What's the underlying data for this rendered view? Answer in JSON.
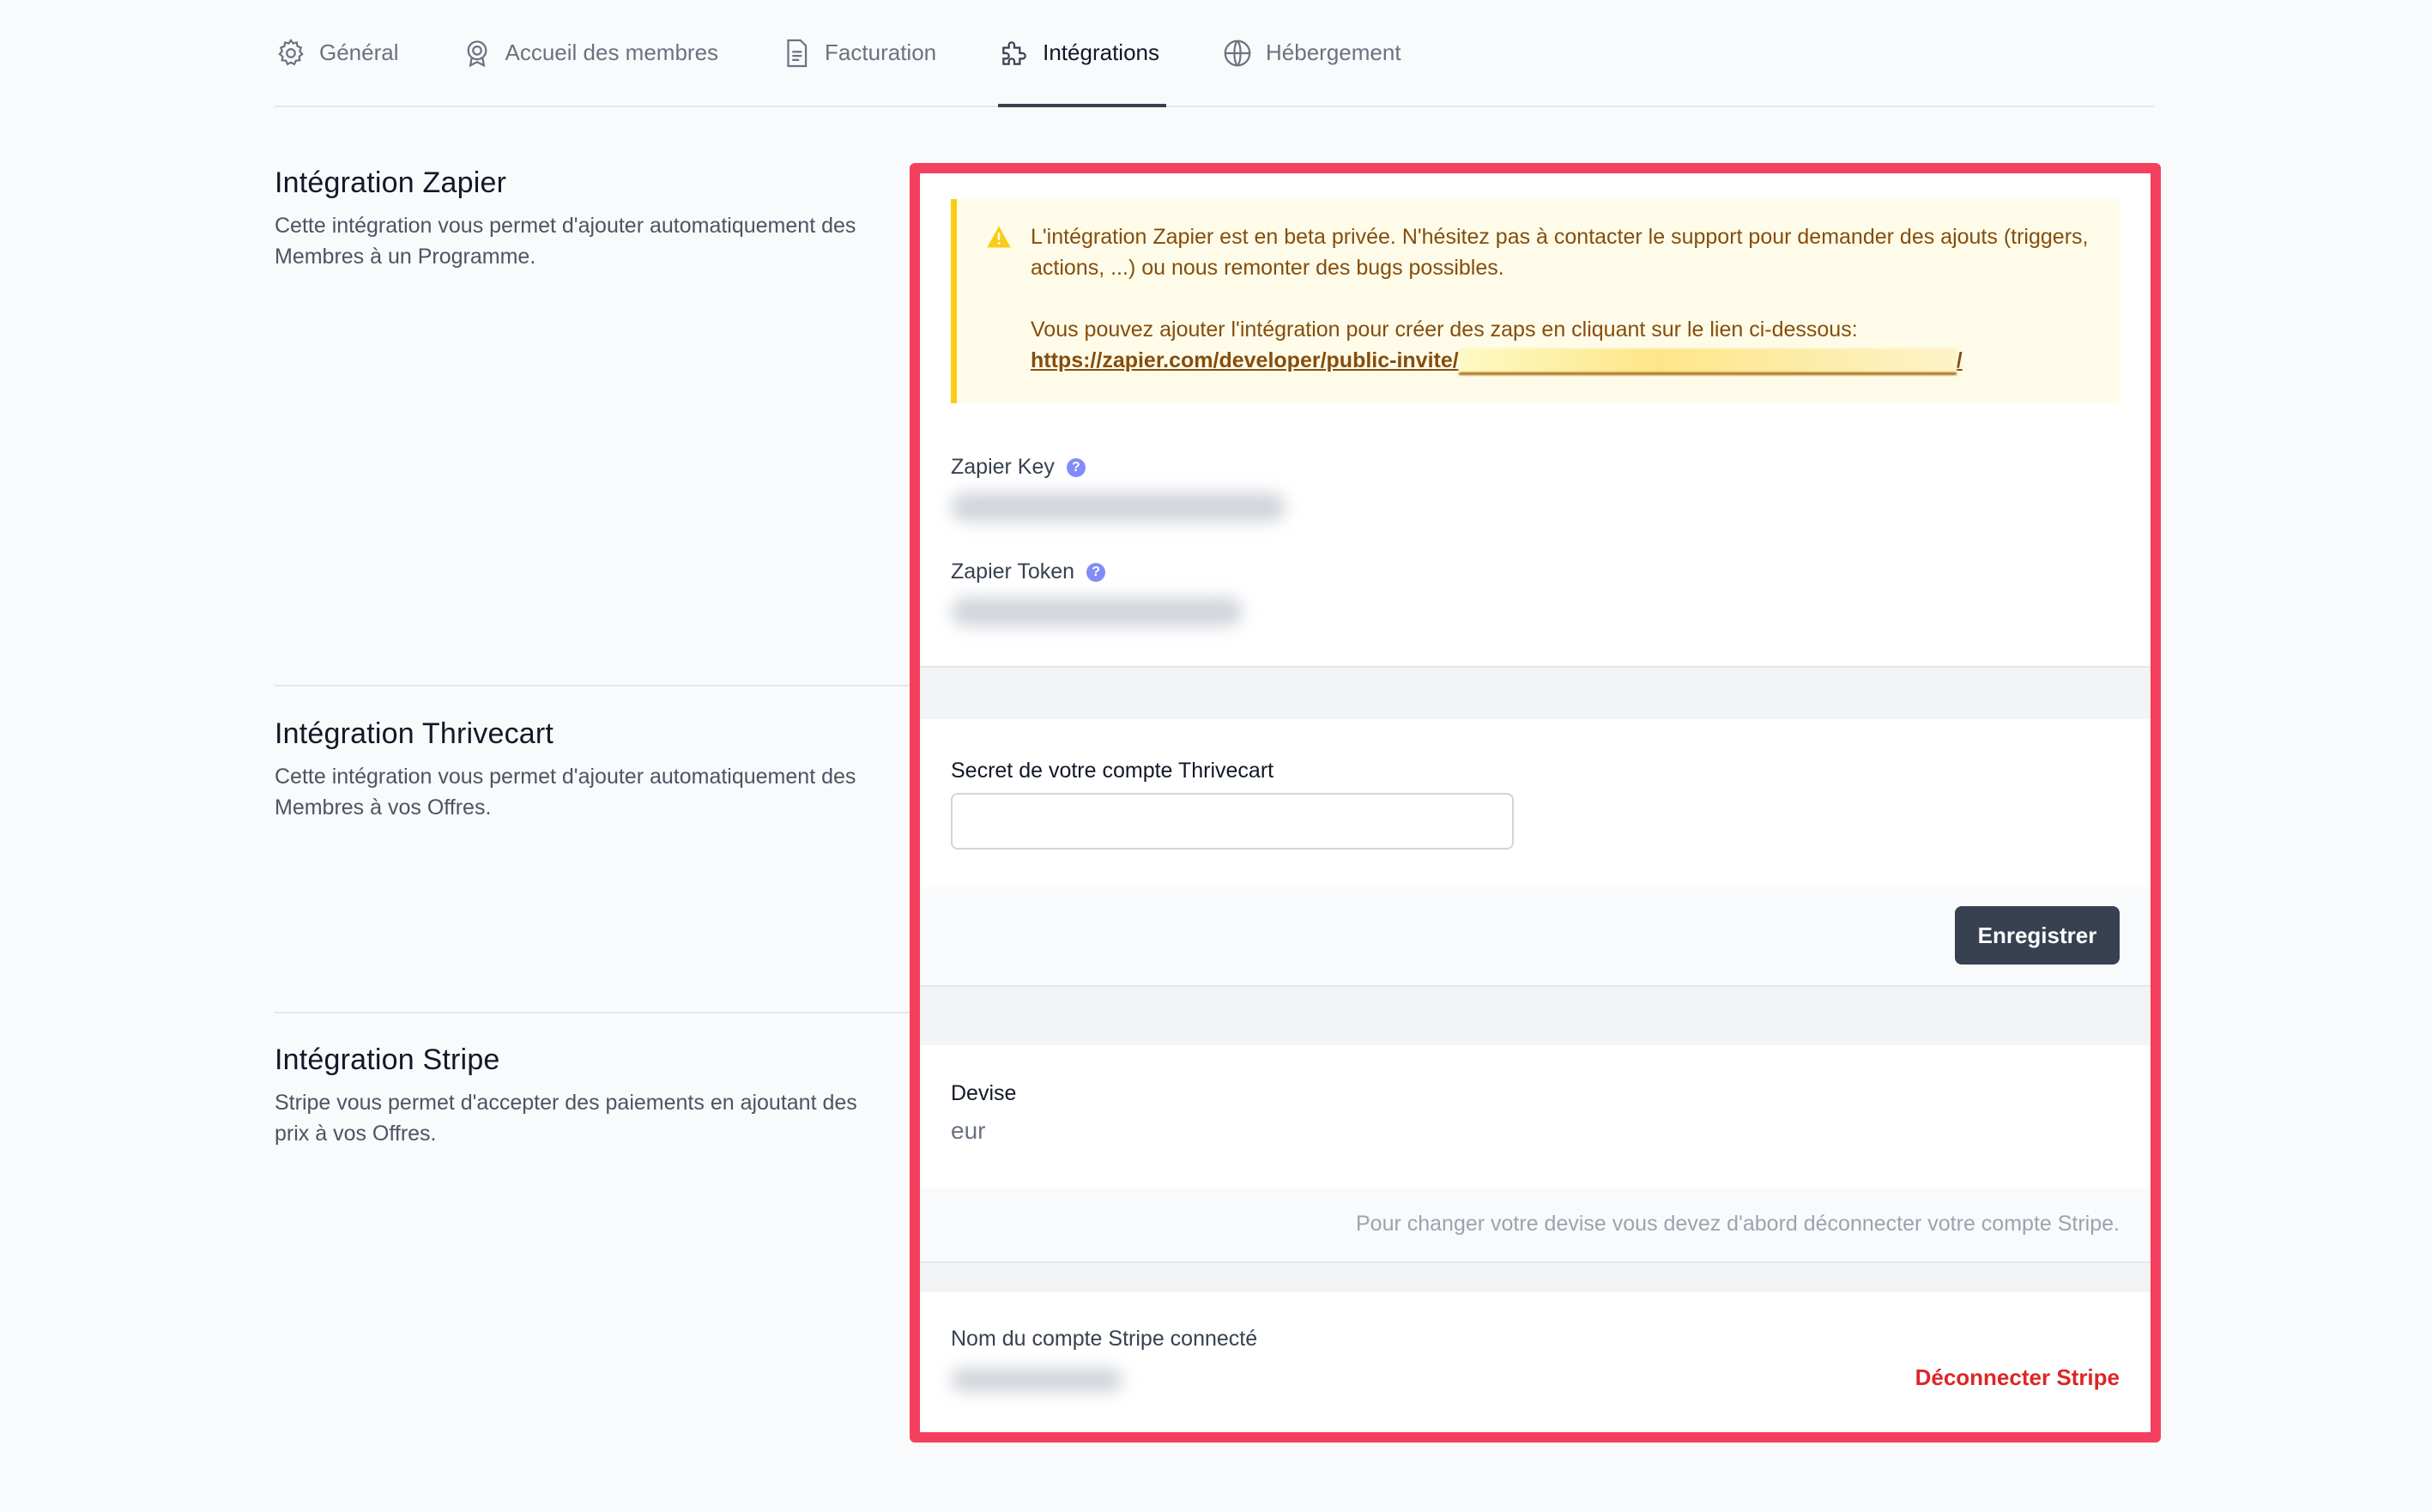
{
  "tabs": [
    {
      "label": "Général",
      "icon": "gear-icon",
      "active": false
    },
    {
      "label": "Accueil des membres",
      "icon": "badge-icon",
      "active": false
    },
    {
      "label": "Facturation",
      "icon": "receipt-icon",
      "active": false
    },
    {
      "label": "Intégrations",
      "icon": "puzzle-icon",
      "active": true
    },
    {
      "label": "Hébergement",
      "icon": "globe-icon",
      "active": false
    }
  ],
  "zapier": {
    "title": "Intégration Zapier",
    "description": "Cette intégration vous permet d'ajouter automatiquement des Membres à un Programme.",
    "alert_line1": "L'intégration Zapier est en beta privée. N'hésitez pas à contacter le support pour demander des ajouts (triggers, actions, ...) ou nous remonter des bugs possibles.",
    "alert_line2": "Vous pouvez ajouter l'intégration pour créer des zaps en cliquant sur le lien ci-dessous:",
    "link_prefix": "https://zapier.com/developer/public-invite/",
    "link_suffix": "/",
    "key_label": "Zapier Key",
    "token_label": "Zapier Token",
    "help_mark": "?"
  },
  "thrivecart": {
    "title": "Intégration Thrivecart",
    "description": "Cette intégration vous permet d'ajouter automatiquement des Membres à vos Offres.",
    "secret_label": "Secret de votre compte Thrivecart",
    "secret_value": "",
    "save_label": "Enregistrer"
  },
  "stripe": {
    "title": "Intégration Stripe",
    "description": "Stripe vous permet d'accepter des paiements en ajoutant des prix à vos Offres.",
    "currency_label": "Devise",
    "currency_value": "eur",
    "currency_hint": "Pour changer votre devise vous devez d'abord déconnecter votre compte Stripe.",
    "account_label": "Nom du compte Stripe connecté",
    "disconnect_label": "Déconnecter Stripe"
  },
  "colors": {
    "highlight_border": "#f43f5e",
    "alert_bg": "#fefce8",
    "alert_border": "#facc15",
    "primary_button": "#374151",
    "danger": "#dc2626"
  }
}
